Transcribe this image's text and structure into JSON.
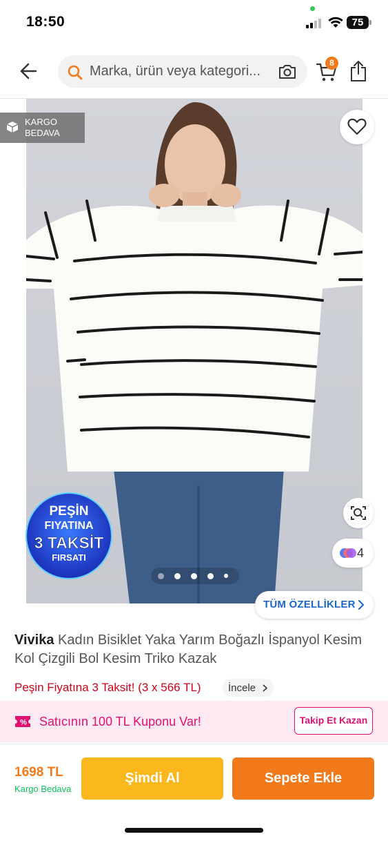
{
  "status_bar": {
    "time": "18:50",
    "battery": "75"
  },
  "header": {
    "search_placeholder": "Marka, ürün veya kategori...",
    "cart_count": "8"
  },
  "gallery": {
    "cargo_badge_line1": "KARGO",
    "cargo_badge_line2": "BEDAVA",
    "color_count": "4",
    "promo_line1": "PEŞİN",
    "promo_line2": "FIYATINA",
    "promo_line3": "3 TAKSİT",
    "promo_line4": "FIRSATI",
    "all_features_label": "TÜM ÖZELLİKLER",
    "active_dot": 1
  },
  "product": {
    "brand": "Vivika",
    "name": "Kadın Bisiklet Yaka Yarım Boğazlı İspanyol Kesim Kol Çizgili Bol Kesim Triko Kazak",
    "installment_text": "Peşin Fiyatına 3 Taksit! (3 x 566 TL)",
    "incele_label": "İncele"
  },
  "coupon": {
    "text": "Satıcının 100 TL Kuponu Var!",
    "follow_label": "Takip Et Kazan"
  },
  "footer": {
    "price": "1698 TL",
    "cargo_free": "Kargo Bedava",
    "buy_now_label": "Şimdi Al",
    "add_to_cart_label": "Sepete Ekle"
  },
  "colors": {
    "brand_orange": "#f27a1a",
    "buy_yellow": "#fbb81c",
    "coupon_pink": "#e0126f",
    "link_blue": "#1a66c7",
    "installment_red": "#d0021b",
    "cargo_green": "#0bc15c"
  }
}
